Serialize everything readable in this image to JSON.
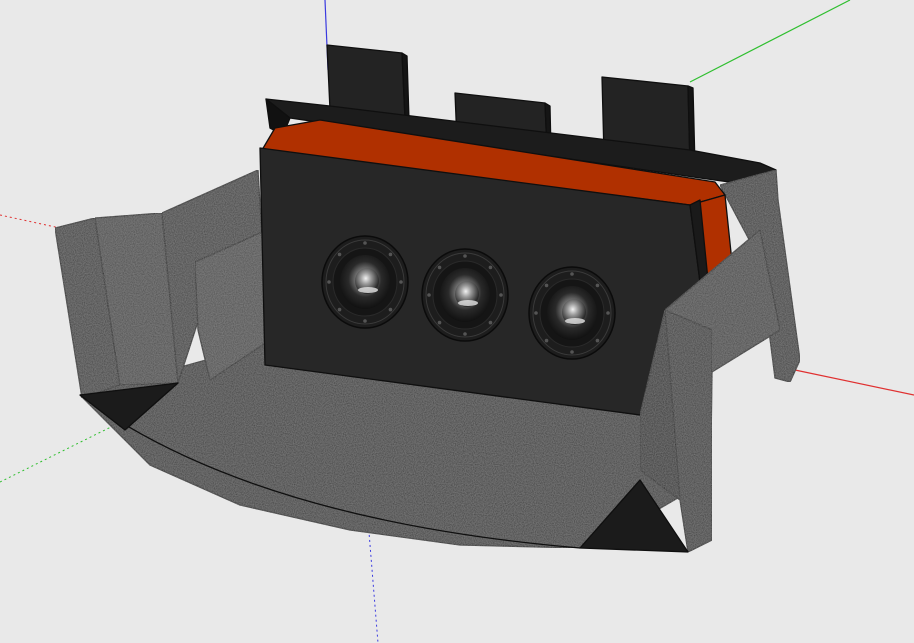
{
  "app": {
    "view": "3d-model-viewport"
  },
  "colors": {
    "background": "#e9e9e9",
    "axis_red": "#e03030",
    "axis_green": "#2fbf2f",
    "axis_blue": "#3a3ae0",
    "carpet_dark": "#2e2e2e",
    "carpet_mid": "#3b3b3b",
    "carpet_light": "#4a4a4a",
    "panel_black": "#222222",
    "edge": "#0f0f0f",
    "accent_orange": "#b03000",
    "subwoofer_chrome": "#bdbdbd"
  },
  "model": {
    "subwoofer_count": 3,
    "top_fins": 3,
    "icons": [
      "subwoofer-driver-icon",
      "subwoofer-driver-icon",
      "subwoofer-driver-icon"
    ]
  }
}
